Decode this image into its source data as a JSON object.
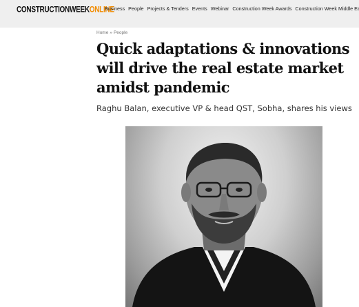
{
  "header": {
    "logo_part1": "CONSTRUCTIONWEEK",
    "logo_part2": "ONLINE",
    "nav": [
      "Business",
      "People",
      "Projects & Tenders",
      "Events",
      "Webinar",
      "Construction Week Awards",
      "Construction Week Middle East"
    ]
  },
  "breadcrumb": {
    "home": "Home",
    "separator": "»",
    "section": "People"
  },
  "article": {
    "title": "Quick adaptations & innovations will drive the real estate market amidst pandemic",
    "subtitle": "Raghu Balan, executive VP & head QST, Sobha, shares his views"
  },
  "colors": {
    "logo_accent": "#f28c00",
    "topbar_bg": "#efefef"
  }
}
